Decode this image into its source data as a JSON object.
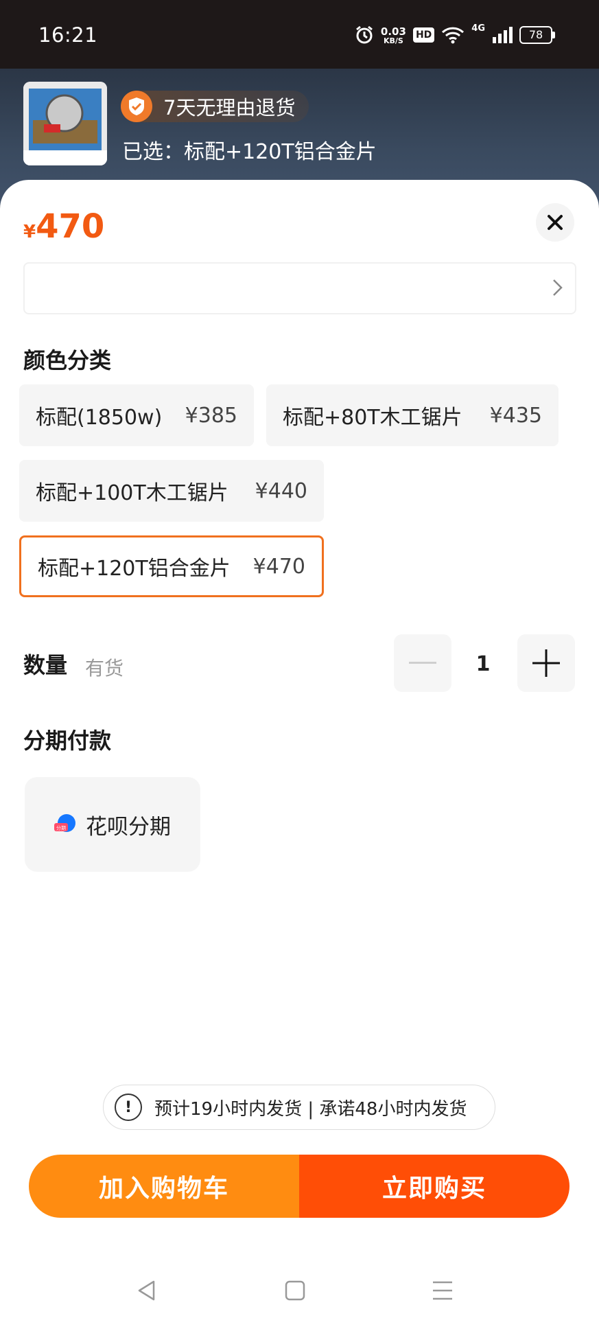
{
  "status_bar": {
    "time": "16:21",
    "speed_value": "0.03",
    "speed_unit": "KB/S",
    "hd": "HD",
    "network": "4G",
    "battery": "78"
  },
  "header": {
    "return_badge": "7天无理由退货",
    "selected_label": "已选：标配+120T铝合金片"
  },
  "price": {
    "currency": "¥",
    "amount": "470"
  },
  "color_section": {
    "title": "颜色分类",
    "options": [
      {
        "label": "标配(1850w)",
        "price": "¥385",
        "selected": false
      },
      {
        "label": "标配+80T木工锯片",
        "price": "¥435",
        "selected": false
      },
      {
        "label": "标配+100T木工锯片",
        "price": "¥440",
        "selected": false
      },
      {
        "label": "标配+120T铝合金片",
        "price": "¥470",
        "selected": true
      }
    ]
  },
  "quantity": {
    "title": "数量",
    "stock": "有货",
    "value": "1"
  },
  "installment": {
    "title": "分期付款",
    "option": "花呗分期",
    "icon_text": "分期"
  },
  "notice": {
    "text": "预计19小时内发货 | 承诺48小时内发货"
  },
  "actions": {
    "add_to_cart": "加入购物车",
    "buy_now": "立即购买"
  },
  "colors": {
    "accent": "#f25a12",
    "cart": "#ff8c11",
    "buy": "#ff4e06",
    "selected_border": "#f0701e"
  }
}
